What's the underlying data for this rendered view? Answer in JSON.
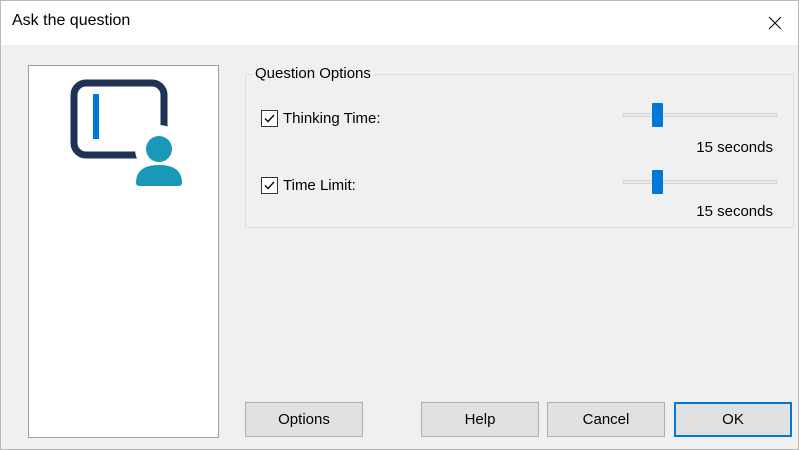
{
  "window": {
    "title": "Ask the question"
  },
  "group": {
    "title": "Question Options",
    "thinking_time": {
      "label": "Thinking Time:",
      "checked": true,
      "value_text": "15 seconds",
      "slider_fraction": 0.2
    },
    "time_limit": {
      "label": "Time Limit:",
      "checked": true,
      "value_text": "15 seconds",
      "slider_fraction": 0.2
    }
  },
  "buttons": {
    "options": "Options",
    "help": "Help",
    "cancel": "Cancel",
    "ok": "OK"
  },
  "icons": {
    "close": "close-icon",
    "illustration": "presenter-board-icon",
    "check": "checkmark-icon"
  },
  "colors": {
    "accent": "#0078d7",
    "board_frame": "#1f3354",
    "board_bar": "#0078d7",
    "person": "#1a98b8"
  }
}
